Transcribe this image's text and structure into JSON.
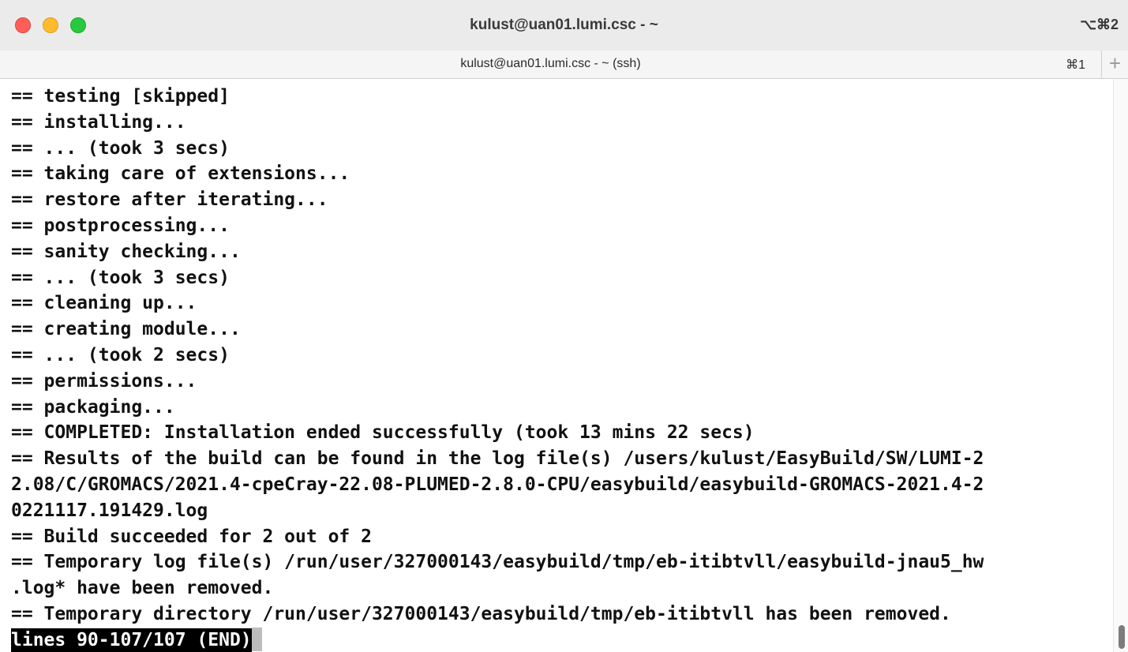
{
  "window": {
    "title": "kulust@uan01.lumi.csc - ~",
    "shortcut": "⌥⌘2"
  },
  "tab": {
    "label": "kulust@uan01.lumi.csc - ~ (ssh)",
    "shortcut": "⌘1",
    "new_tab": "+"
  },
  "terminal": {
    "lines": [
      "== testing [skipped]",
      "== installing...",
      "== ... (took 3 secs)",
      "== taking care of extensions...",
      "== restore after iterating...",
      "== postprocessing...",
      "== sanity checking...",
      "== ... (took 3 secs)",
      "== cleaning up...",
      "== creating module...",
      "== ... (took 2 secs)",
      "== permissions...",
      "== packaging...",
      "== COMPLETED: Installation ended successfully (took 13 mins 22 secs)",
      "== Results of the build can be found in the log file(s) /users/kulust/EasyBuild/SW/LUMI-2",
      "2.08/C/GROMACS/2021.4-cpeCray-22.08-PLUMED-2.8.0-CPU/easybuild/easybuild-GROMACS-2021.4-2",
      "0221117.191429.log",
      "== Build succeeded for 2 out of 2",
      "== Temporary log file(s) /run/user/327000143/easybuild/tmp/eb-itibtvll/easybuild-jnau5_hw",
      ".log* have been removed.",
      "== Temporary directory /run/user/327000143/easybuild/tmp/eb-itibtvll has been removed."
    ],
    "pager_status": "lines 90-107/107 (END)"
  }
}
